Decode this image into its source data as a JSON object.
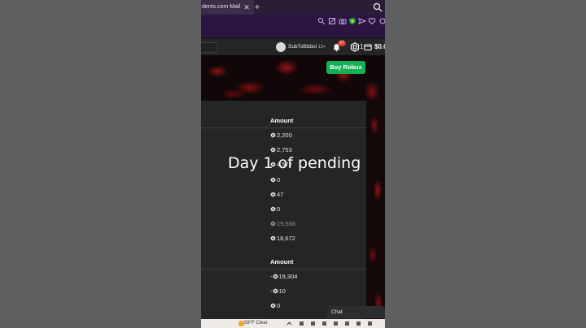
{
  "browser": {
    "tab_title": "dents.com Mail",
    "tab_close": "✕",
    "new_tab": "+"
  },
  "nav": {
    "username": "SubToBbbol",
    "age_tag": "13+",
    "notification_count": "37",
    "robux_count": "1",
    "balance": "$0.0"
  },
  "banner": {
    "buy_robux_label": "Buy Robux"
  },
  "incoming": {
    "header": "Amount",
    "rows": [
      {
        "amount": "2,200"
      },
      {
        "amount": "2,753"
      },
      {
        "amount": "4,572"
      },
      {
        "amount": "0"
      },
      {
        "amount": "47"
      },
      {
        "amount": "0"
      },
      {
        "amount": "19,568",
        "muted": true
      },
      {
        "amount": "18,672"
      }
    ]
  },
  "outgoing": {
    "header": "Amount",
    "rows": [
      {
        "amount": "-19,304"
      },
      {
        "amount": "-10"
      },
      {
        "amount": "0"
      }
    ]
  },
  "chat_label": "Chat",
  "taskbar": {
    "weather": "59°F  Clear"
  },
  "overlay_caption": "Day 1 of pending",
  "colors": {
    "buy_button": "#16b157",
    "panel": "#232527",
    "notification_badge": "#e0322f"
  }
}
